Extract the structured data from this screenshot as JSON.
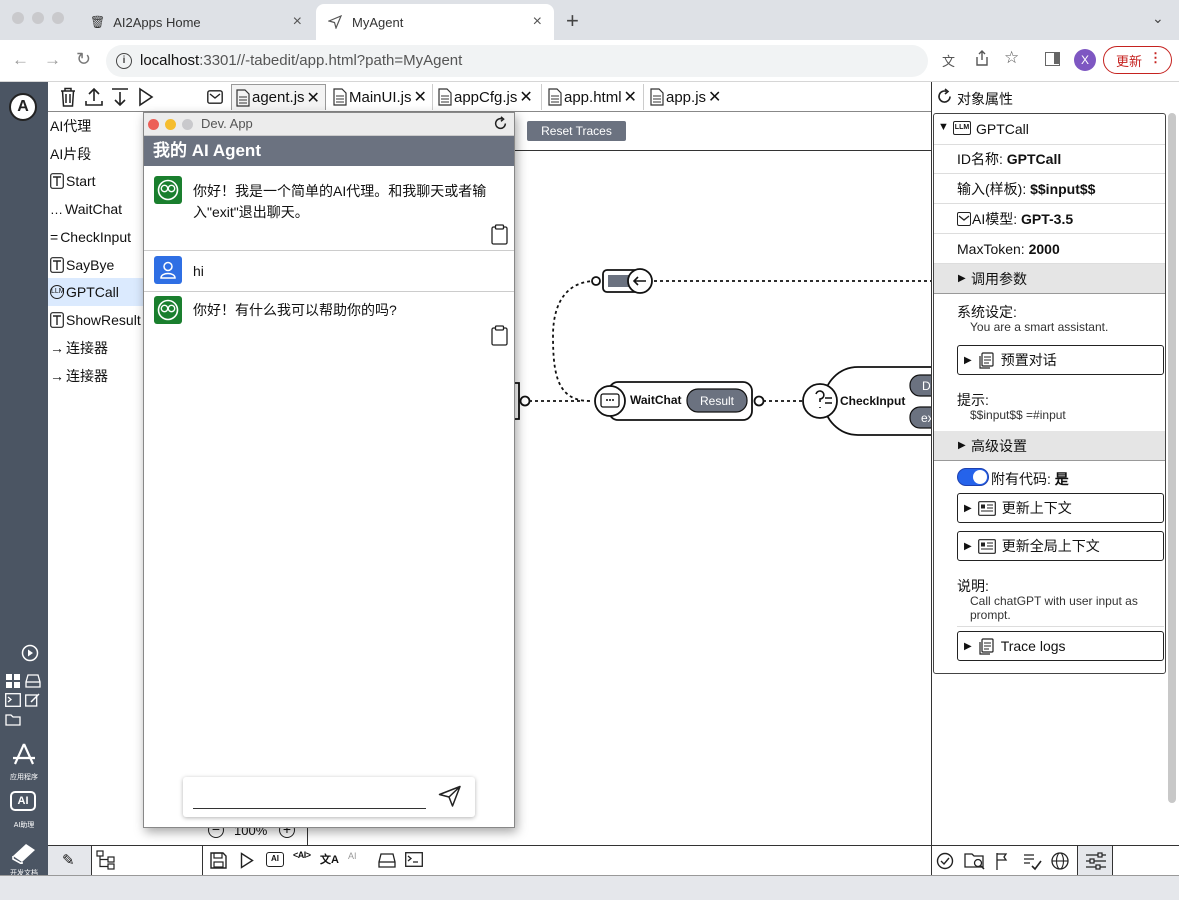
{
  "browser": {
    "tabs": [
      {
        "title": "AI2Apps Home"
      },
      {
        "title": "MyAgent"
      }
    ],
    "url_host": "localhost",
    "url_rest": ":3301//-tabedit/app.html?path=MyAgent",
    "profile_initial": "X",
    "update_label": "更新"
  },
  "rail": {
    "logo": "A",
    "apps_label": "应用程序",
    "ai_badge": "AI",
    "ai_label": "AI助理",
    "docs_label": "开发文档"
  },
  "editor_tabs": [
    {
      "label": "agent.js"
    },
    {
      "label": "MainUI.js"
    },
    {
      "label": "appCfg.js"
    },
    {
      "label": "app.html"
    },
    {
      "label": "app.js"
    }
  ],
  "nav": {
    "items": [
      {
        "label": "AI代理"
      },
      {
        "label": "AI片段"
      },
      {
        "label": "Start"
      },
      {
        "label": "WaitChat"
      },
      {
        "label": "CheckInput"
      },
      {
        "label": "SayBye"
      },
      {
        "label": "GPTCall"
      },
      {
        "label": "ShowResult"
      },
      {
        "label": "连接器"
      },
      {
        "label": "连接器"
      }
    ]
  },
  "canvas": {
    "reset_traces": "Reset Traces",
    "zoom": "100%",
    "nodes": {
      "waitchat": "WaitChat",
      "result": "Result",
      "checkinput": "CheckInput",
      "d_label": "D",
      "e_label": "ex"
    }
  },
  "devapp": {
    "title": "Dev. App",
    "header": "我的 AI Agent",
    "messages": [
      {
        "role": "ai",
        "text": "你好！我是一个简单的AI代理。和我聊天或者输入\"exit\"退出聊天。"
      },
      {
        "role": "user",
        "text": "hi"
      },
      {
        "role": "ai",
        "text": "你好！有什么我可以帮助你的吗?"
      }
    ]
  },
  "props": {
    "panel_title": "对象属性",
    "node_badge": "LLM",
    "node_name": "GPTCall",
    "id_label": "ID名称:",
    "id_value": "GPTCall",
    "input_label": "输入(样板):",
    "input_value": "$$input$$",
    "model_label": "AI模型:",
    "model_value": "GPT-3.5",
    "maxtoken_label": "MaxToken:",
    "maxtoken_value": "2000",
    "call_params": "调用参数",
    "system_label": "系统设定:",
    "system_value": "You are a smart assistant.",
    "preset_dialog": "预置对话",
    "prompt_label": "提示:",
    "prompt_value": "$$input$$ =#input",
    "advanced": "高级设置",
    "code_label": "附有代码:",
    "code_value": "是",
    "update_context": "更新上下文",
    "update_global_context": "更新全局上下文",
    "desc_label": "说明:",
    "desc_value": "Call chatGPT with user input as prompt.",
    "trace_logs": "Trace logs"
  },
  "colors": {
    "rail": "#4b5563",
    "dev_header": "#6b7280",
    "ai_avatar": "#1a7f2e",
    "user_avatar": "#2f6fe4",
    "toggle": "#2563eb",
    "update": "#c5221f"
  }
}
